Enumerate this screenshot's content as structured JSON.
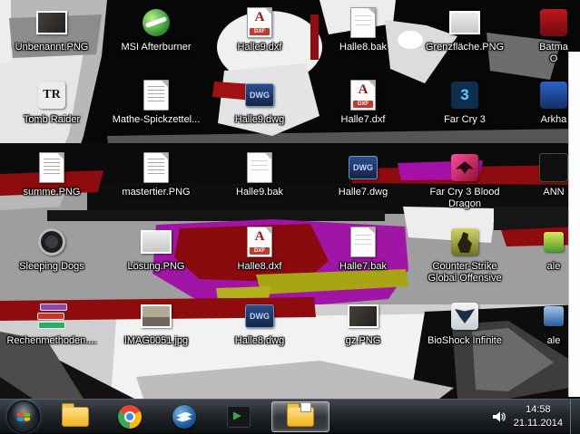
{
  "colors": {
    "taskbar_top": "#41464d",
    "taskbar_bottom": "#0e1012",
    "label_text": "#ffffff",
    "wallpaper_black": "#070707",
    "wallpaper_gray": "#9e9e9e",
    "wallpaper_red": "#8e0b0e",
    "wallpaper_magenta": "#a015a5",
    "wallpaper_yellow": "#a8a414",
    "right_strip": "#fdfdfd"
  },
  "art": {
    "dxf_letter": "A",
    "dxf_badge": "DXF",
    "dwg_text": "DWG",
    "tr_text": "TR",
    "fc3_text": "3"
  },
  "desktop": {
    "icons": [
      {
        "label": "Unbenannt.PNG",
        "type": "thumb-dark"
      },
      {
        "label": "MSI Afterburner",
        "type": "msi"
      },
      {
        "label": "Halle9.dxf",
        "type": "dxf"
      },
      {
        "label": "Halle8.bak",
        "type": "bak"
      },
      {
        "label": "Grenzfläche.PNG",
        "type": "thumb-light"
      },
      {
        "label": "Batma",
        "label2": "O",
        "type": "batman"
      },
      {
        "label": "Tomb Raider",
        "type": "tr"
      },
      {
        "label": "Mathe-Spickzettel...",
        "type": "page-notes"
      },
      {
        "label": "Halle9.dwg",
        "type": "dwg"
      },
      {
        "label": "Halle7.dxf",
        "type": "dxf"
      },
      {
        "label": "Far Cry 3",
        "type": "fc3"
      },
      {
        "label": "Arkha",
        "type": "arkham"
      },
      {
        "label": "summe.PNG",
        "type": "page-notes"
      },
      {
        "label": "mastertier.PNG",
        "type": "page-notes"
      },
      {
        "label": "Halle9.bak",
        "type": "bak"
      },
      {
        "label": "Halle7.dwg",
        "type": "dwg"
      },
      {
        "label": "Far Cry 3 Blood Dragon",
        "type": "fcbd"
      },
      {
        "label": "ANN",
        "type": "dark-app"
      },
      {
        "label": "Sleeping Dogs",
        "type": "sd"
      },
      {
        "label": "Lösung.PNG",
        "type": "thumb-light"
      },
      {
        "label": "Halle8.dxf",
        "type": "dxf"
      },
      {
        "label": "Halle7.bak",
        "type": "bak"
      },
      {
        "label": "Counter-Strike Global Offensive",
        "type": "csgo"
      },
      {
        "label": "ale",
        "type": "small-green"
      },
      {
        "label": "Rechenmethoden....",
        "type": "rar"
      },
      {
        "label": "IMAG0051.jpg",
        "type": "thumb-photo"
      },
      {
        "label": "Halle8.dwg",
        "type": "dwg"
      },
      {
        "label": "gz.PNG",
        "type": "thumb-dark"
      },
      {
        "label": "BioShock Infinite",
        "type": "bsi"
      },
      {
        "label": "ale",
        "type": "small-blue"
      }
    ]
  },
  "taskbar": {
    "pinned_icons": [
      "start",
      "explorer-folder",
      "chrome",
      "thunderbird",
      "dark-app"
    ],
    "open_windows": [
      {
        "icon": "explorer-folder-open",
        "active": true
      }
    ],
    "tray": {
      "volume_icon": "speaker",
      "time": "14:58",
      "date": "21.11.2014"
    }
  }
}
